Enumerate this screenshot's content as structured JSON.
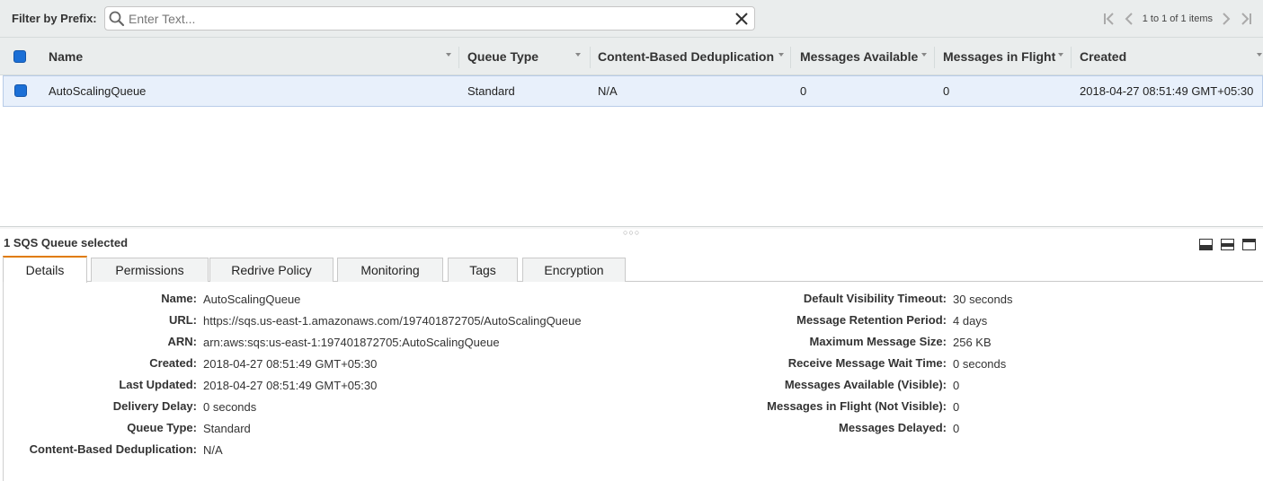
{
  "filter": {
    "label": "Filter by Prefix:",
    "placeholder": "Enter Text...",
    "value": ""
  },
  "pager": {
    "text": "1 to 1 of 1 items"
  },
  "table": {
    "columns": [
      {
        "label": "Name"
      },
      {
        "label": "Queue Type"
      },
      {
        "label": "Content-Based Deduplication"
      },
      {
        "label": "Messages Available"
      },
      {
        "label": "Messages in Flight"
      },
      {
        "label": "Created"
      }
    ],
    "rows": [
      {
        "name": "AutoScalingQueue",
        "queue_type": "Standard",
        "dedup": "N/A",
        "available": "0",
        "in_flight": "0",
        "created": "2018-04-27 08:51:49 GMT+05:30",
        "selected": true
      }
    ]
  },
  "detail": {
    "selected_text": "1 SQS Queue selected",
    "tabs": [
      "Details",
      "Permissions",
      "Redrive Policy",
      "Monitoring",
      "Tags",
      "Encryption"
    ],
    "active_tab": "Details",
    "left": [
      {
        "label": "Name:",
        "value": "AutoScalingQueue"
      },
      {
        "label": "URL:",
        "value": "https://sqs.us-east-1.amazonaws.com/197401872705/AutoScalingQueue"
      },
      {
        "label": "ARN:",
        "value": "arn:aws:sqs:us-east-1:197401872705:AutoScalingQueue"
      },
      {
        "label": "Created:",
        "value": "2018-04-27 08:51:49 GMT+05:30"
      },
      {
        "label": "Last Updated:",
        "value": "2018-04-27 08:51:49 GMT+05:30"
      },
      {
        "label": "Delivery Delay:",
        "value": "0 seconds"
      },
      {
        "label": "Queue Type:",
        "value": "Standard"
      },
      {
        "label": "Content-Based Deduplication:",
        "value": "N/A"
      }
    ],
    "right": [
      {
        "label": "Default Visibility Timeout:",
        "value": "30 seconds"
      },
      {
        "label": "Message Retention Period:",
        "value": "4 days"
      },
      {
        "label": "Maximum Message Size:",
        "value": "256 KB"
      },
      {
        "label": "Receive Message Wait Time:",
        "value": "0 seconds"
      },
      {
        "label": "Messages Available (Visible):",
        "value": "0"
      },
      {
        "label": "Messages in Flight (Not Visible):",
        "value": "0"
      },
      {
        "label": "Messages Delayed:",
        "value": "0"
      }
    ]
  },
  "colors": {
    "selection_blue": "#1b6fd6",
    "row_highlight": "#e8f0fb",
    "tab_accent": "#e07b00",
    "header_bg": "#eaeded"
  }
}
